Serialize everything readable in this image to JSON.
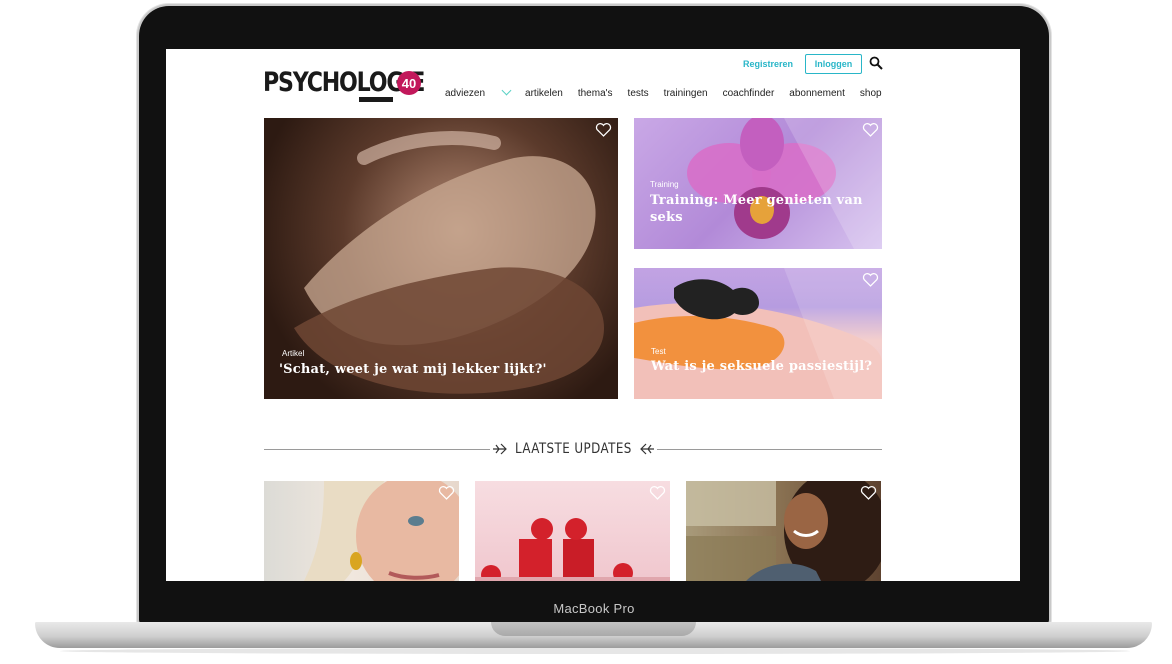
{
  "device": {
    "label": "MacBook Pro"
  },
  "site": {
    "logo_text": "PSYCHOLOGIE",
    "logo_badge": "40"
  },
  "header": {
    "register_label": "Registreren",
    "login_label": "Inloggen"
  },
  "nav": {
    "items": [
      "adviezen",
      "artikelen",
      "thema's",
      "tests",
      "trainingen",
      "coachfinder",
      "abonnement",
      "shop"
    ]
  },
  "featured": [
    {
      "tag": "Artikel",
      "title": "'Schat, weet je wat mij lekker lijkt?'"
    },
    {
      "tag": "Training",
      "title": "Training: Meer genieten van seks"
    },
    {
      "tag": "Test",
      "title": "Wat is je seksuele passiestijl?"
    }
  ],
  "updates": {
    "heading": "LAATSTE UPDATES"
  },
  "colors": {
    "accent": "#29b6c8",
    "badge": "#c2185b"
  }
}
